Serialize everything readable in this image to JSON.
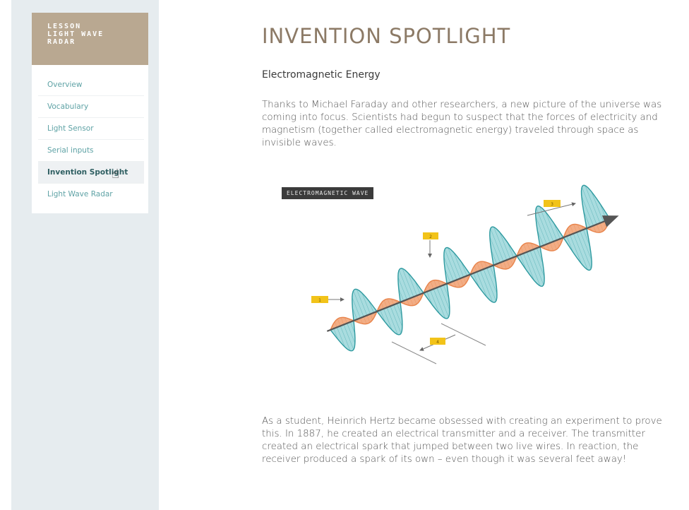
{
  "sidebar": {
    "lesson_lines": [
      "LESSON",
      "LIGHT WAVE",
      "RADAR"
    ],
    "items": [
      {
        "label": "Overview"
      },
      {
        "label": "Vocabulary"
      },
      {
        "label": "Light Sensor"
      },
      {
        "label": "Serial inputs"
      },
      {
        "label": "Invention Spotlight",
        "active": true
      },
      {
        "label": "Light Wave Radar"
      }
    ]
  },
  "main": {
    "title": "INVENTION SPOTLIGHT",
    "subheading": "Electromagnetic Energy",
    "paragraph1": "Thanks to Michael Faraday and other researchers, a new picture of the universe was coming into focus. Scientists had begun to suspect that the forces of electricity and magnetism (together called electromagnetic energy) traveled through space as invisible waves.",
    "diagram": {
      "label": "ELECTROMAGNETIC WAVE",
      "tags": [
        "1",
        "2",
        "3",
        "4"
      ]
    },
    "paragraph2": "As a student, Heinrich Hertz became obsessed with creating an experiment to prove this. In 1887, he created an electrical transmitter and a receiver. The transmitter created an electrical spark that jumped between two live wires. In reaction, the receiver produced a spark of its own – even though it was several feet away!"
  },
  "colors": {
    "header_bg": "#b9a891",
    "nav_link": "#5ea2a5",
    "title": "#8c7a66",
    "wave_teal": "#4fb8bd",
    "wave_orange": "#e8834a",
    "tag_yellow": "#f2c319"
  },
  "icons": {
    "cursor": "hand-pointer-icon"
  }
}
